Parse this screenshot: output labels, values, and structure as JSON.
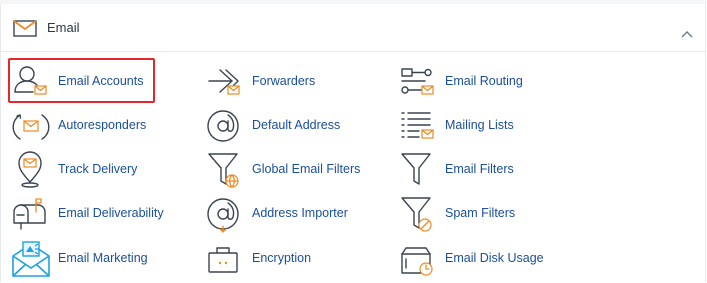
{
  "section": {
    "title": "Email",
    "icon": "envelope-icon",
    "collapse_icon": "chevron-up-icon"
  },
  "tools": [
    {
      "label": "Email Accounts",
      "icon": "email-accounts-icon",
      "selected": true
    },
    {
      "label": "Forwarders",
      "icon": "forwarders-icon"
    },
    {
      "label": "Email Routing",
      "icon": "email-routing-icon"
    },
    {
      "label": "Autoresponders",
      "icon": "autoresponders-icon"
    },
    {
      "label": "Default Address",
      "icon": "default-address-icon"
    },
    {
      "label": "Mailing Lists",
      "icon": "mailing-lists-icon"
    },
    {
      "label": "Track Delivery",
      "icon": "track-delivery-icon"
    },
    {
      "label": "Global Email Filters",
      "icon": "global-email-filters-icon"
    },
    {
      "label": "Email Filters",
      "icon": "email-filters-icon"
    },
    {
      "label": "Email Deliverability",
      "icon": "email-deliverability-icon"
    },
    {
      "label": "Address Importer",
      "icon": "address-importer-icon"
    },
    {
      "label": "Spam Filters",
      "icon": "spam-filters-icon"
    },
    {
      "label": "Email Marketing",
      "icon": "email-marketing-icon"
    },
    {
      "label": "Encryption",
      "icon": "encryption-icon"
    },
    {
      "label": "Email Disk Usage",
      "icon": "email-disk-usage-icon"
    }
  ],
  "colors": {
    "link": "#1b4f9c",
    "accent": "#f08a24",
    "selection_border": "#e8262a",
    "icon_stroke": "#3a4451",
    "marketing_blue": "#1aa3e0"
  }
}
